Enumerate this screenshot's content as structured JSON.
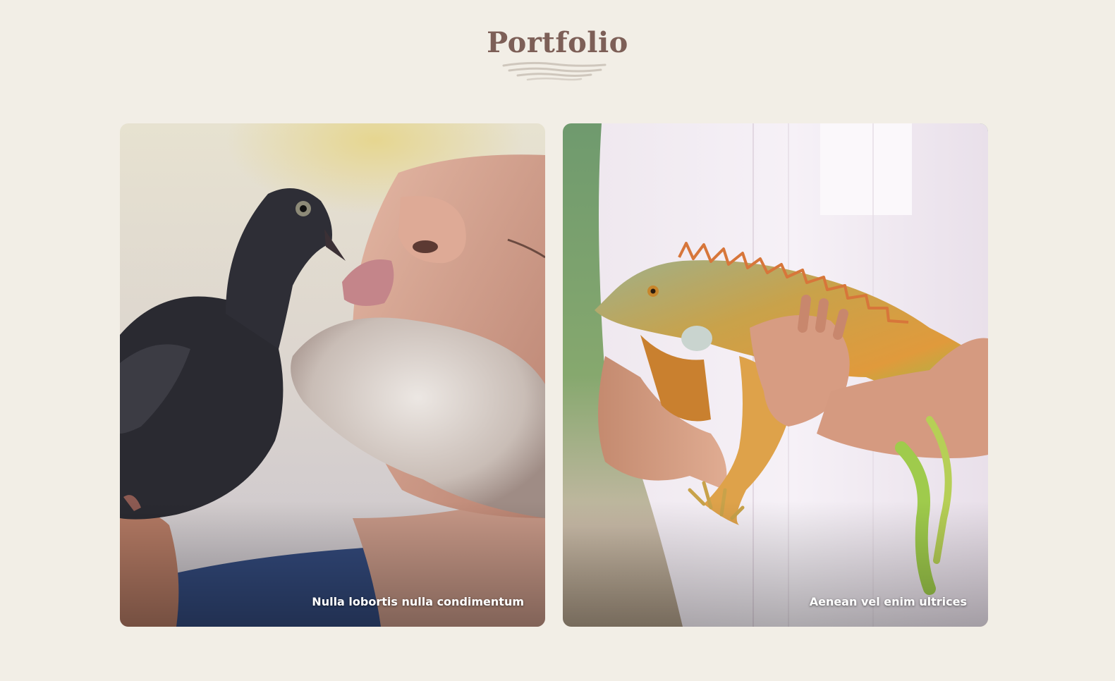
{
  "section": {
    "title": "Portfolio"
  },
  "portfolio": {
    "items": [
      {
        "caption": "Nulla lobortis nulla condimentum",
        "image": "man-kissing-pigeon-photo"
      },
      {
        "caption": "Aenean vel enim ultrices",
        "image": "hands-holding-iguana-photo"
      }
    ]
  },
  "colors": {
    "background": "#f2eee6",
    "title": "#7d5f57",
    "divider": "#cfc7bd",
    "caption": "#ffffff"
  }
}
